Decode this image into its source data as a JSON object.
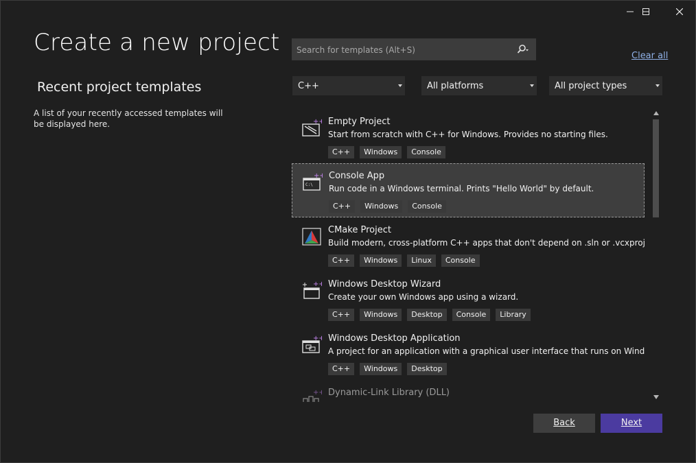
{
  "window": {
    "minimize_glyph": "—",
    "maximize_glyph": "☐",
    "close_glyph": "✕"
  },
  "page_title": "Create a new project",
  "recent": {
    "heading": "Recent project templates",
    "description": "A list of your recently accessed templates will be displayed here."
  },
  "search": {
    "placeholder": "Search for templates (Alt+S)",
    "value": ""
  },
  "clear_all": "Clear all",
  "filters": {
    "language": "C++",
    "platform": "All platforms",
    "project_type": "All project types"
  },
  "templates": [
    {
      "name": "Empty Project",
      "description": "Start from scratch with C++ for Windows. Provides no starting files.",
      "tags": [
        "C++",
        "Windows",
        "Console"
      ],
      "icon": "empty-project-icon",
      "selected": false
    },
    {
      "name": "Console App",
      "description": "Run code in a Windows terminal. Prints \"Hello World\" by default.",
      "tags": [
        "C++",
        "Windows",
        "Console"
      ],
      "icon": "console-app-icon",
      "selected": true
    },
    {
      "name": "CMake Project",
      "description": "Build modern, cross-platform C++ apps that don't depend on .sln or .vcxproj files.",
      "tags": [
        "C++",
        "Windows",
        "Linux",
        "Console"
      ],
      "icon": "cmake-icon",
      "selected": false
    },
    {
      "name": "Windows Desktop Wizard",
      "description": "Create your own Windows app using a wizard.",
      "tags": [
        "C++",
        "Windows",
        "Desktop",
        "Console",
        "Library"
      ],
      "icon": "desktop-wizard-icon",
      "selected": false
    },
    {
      "name": "Windows Desktop Application",
      "description": "A project for an application with a graphical user interface that runs on Windows.",
      "tags": [
        "C++",
        "Windows",
        "Desktop"
      ],
      "icon": "desktop-app-icon",
      "selected": false
    },
    {
      "name": "Dynamic-Link Library (DLL)",
      "description": "",
      "tags": [],
      "icon": "dll-icon",
      "selected": false
    }
  ],
  "buttons": {
    "back": "Back",
    "next": "Next"
  },
  "colors": {
    "background": "#1f1f1f",
    "accent": "#4b3ba0",
    "link": "#8fb0e6",
    "icon_plus": "#c586f0"
  }
}
